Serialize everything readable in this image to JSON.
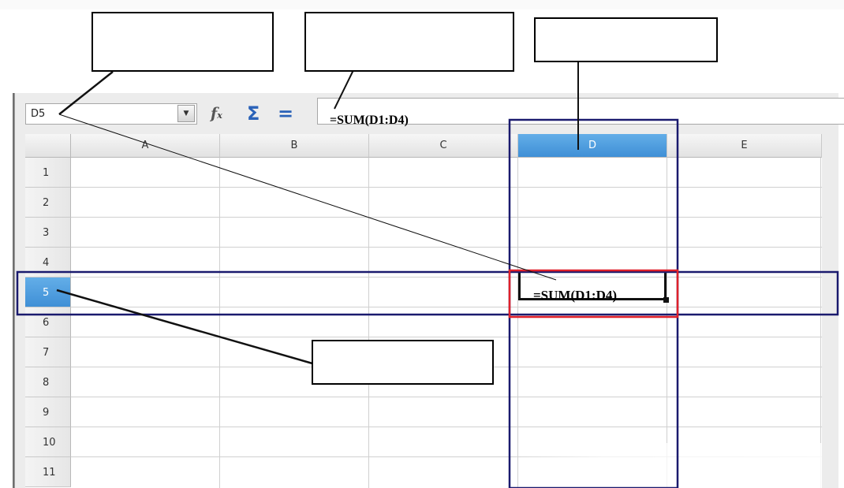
{
  "name_box": {
    "value": "D5"
  },
  "formula_bar": {
    "function_wizard_icon": "fx-icon",
    "sum_icon": "sigma-icon",
    "equals_icon": "equals-icon",
    "formula": "=SUM(D1:D4)"
  },
  "columns": [
    "A",
    "B",
    "C",
    "D",
    "E"
  ],
  "rows": [
    "1",
    "2",
    "3",
    "4",
    "5",
    "6",
    "7",
    "8",
    "9",
    "10",
    "11"
  ],
  "selected": {
    "column": "D",
    "row": "5"
  },
  "active_cell": {
    "content": "=SUM(D1:D4)"
  },
  "callouts": [
    {
      "label": ""
    },
    {
      "label": ""
    },
    {
      "label": ""
    },
    {
      "label": ""
    }
  ],
  "colors": {
    "selection_header": "#4a9ae0",
    "highlight_outline": "#1a1a6e",
    "active_cell_frame": "#e0202a"
  }
}
